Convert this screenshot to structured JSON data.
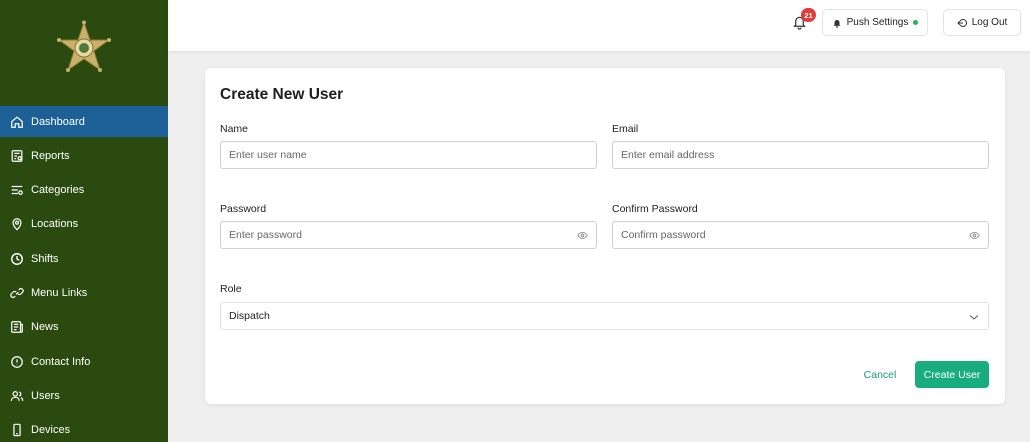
{
  "sidebar": {
    "items": [
      {
        "label": "Dashboard",
        "icon": "home-icon",
        "active": true
      },
      {
        "label": "Reports",
        "icon": "report-icon",
        "active": false
      },
      {
        "label": "Categories",
        "icon": "categories-icon",
        "active": false
      },
      {
        "label": "Locations",
        "icon": "location-pin-icon",
        "active": false
      },
      {
        "label": "Shifts",
        "icon": "clock-icon",
        "active": false
      },
      {
        "label": "Menu Links",
        "icon": "link-icon",
        "active": false
      },
      {
        "label": "News",
        "icon": "newspaper-icon",
        "active": false
      },
      {
        "label": "Contact Info",
        "icon": "info-icon",
        "active": false
      },
      {
        "label": "Users",
        "icon": "users-icon",
        "active": false
      },
      {
        "label": "Devices",
        "icon": "device-icon",
        "active": false
      }
    ]
  },
  "topbar": {
    "notification_count": "21",
    "push_settings_label": "Push Settings",
    "push_status_color": "#22b35b",
    "logout_label": "Log Out"
  },
  "form": {
    "title": "Create New User",
    "name": {
      "label": "Name",
      "placeholder": "Enter user name",
      "value": ""
    },
    "email": {
      "label": "Email",
      "placeholder": "Enter email address",
      "value": ""
    },
    "password": {
      "label": "Password",
      "placeholder": "Enter password",
      "value": ""
    },
    "confirm_password": {
      "label": "Confirm Password",
      "placeholder": "Confirm password",
      "value": ""
    },
    "role": {
      "label": "Role",
      "selected": "Dispatch"
    },
    "cancel_label": "Cancel",
    "submit_label": "Create User"
  },
  "colors": {
    "sidebar_bg": "#2b4a0f",
    "active_item": "#1d5f97",
    "accent": "#18ad7c",
    "badge": "#e03b3b"
  }
}
